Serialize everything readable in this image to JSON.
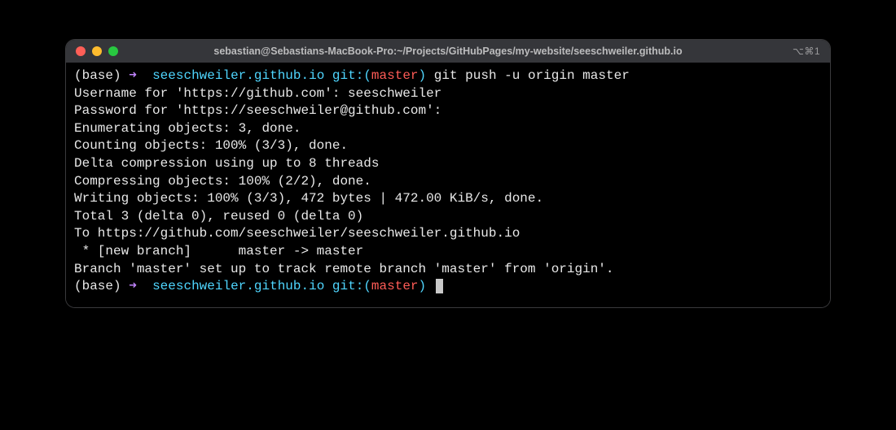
{
  "window": {
    "title": "sebastian@Sebastians-MacBook-Pro:~/Projects/GitHubPages/my-website/seeschweiler.github.io",
    "tab_indicator": "⌥⌘1"
  },
  "prompt": {
    "base": "(base)",
    "arrow": "➜",
    "dir": "seeschweiler.github.io",
    "gitword": "git:",
    "paren_open": "(",
    "branch": "master",
    "paren_close": ")",
    "command1": "git push -u origin master"
  },
  "output": {
    "l1": "Username for 'https://github.com': seeschweiler",
    "l2": "Password for 'https://seeschweiler@github.com':",
    "l3": "Enumerating objects: 3, done.",
    "l4": "Counting objects: 100% (3/3), done.",
    "l5": "Delta compression using up to 8 threads",
    "l6": "Compressing objects: 100% (2/2), done.",
    "l7": "Writing objects: 100% (3/3), 472 bytes | 472.00 KiB/s, done.",
    "l8": "Total 3 (delta 0), reused 0 (delta 0)",
    "l9": "To https://github.com/seeschweiler/seeschweiler.github.io",
    "l10": " * [new branch]      master -> master",
    "l11": "Branch 'master' set up to track remote branch 'master' from 'origin'."
  }
}
